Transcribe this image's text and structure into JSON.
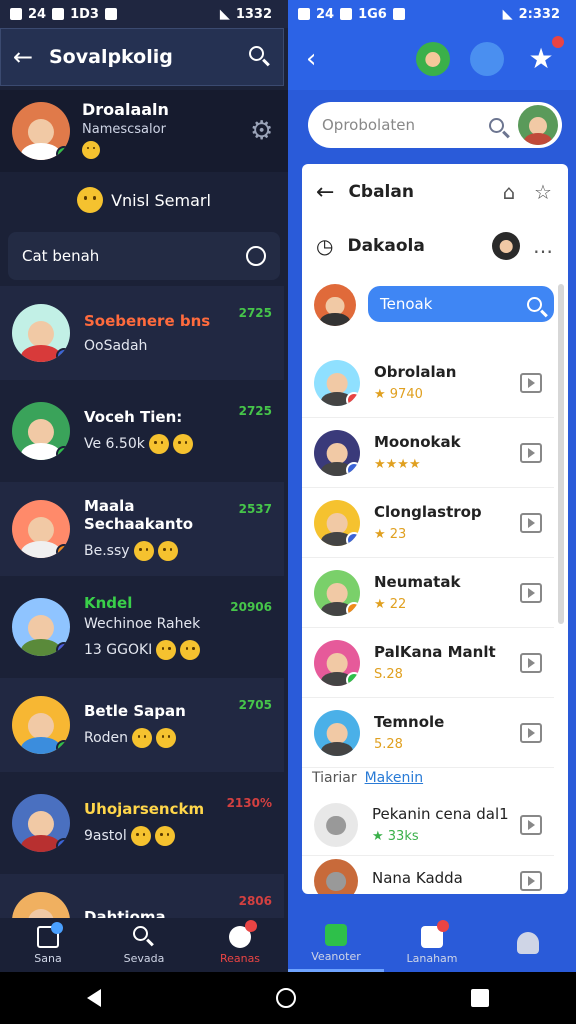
{
  "status_left": {
    "time": "1332",
    "carrier": "24",
    "net": "1D3"
  },
  "status_right": {
    "time": "2:332",
    "carrier": "24",
    "net": "1G6"
  },
  "left_header": {
    "title": "Sovalpkolig"
  },
  "profile": {
    "name": "Droalaaln",
    "sub": "Namescsalor"
  },
  "visit": {
    "label": "Vnisl Semarl"
  },
  "filter": {
    "label": "Cat benah"
  },
  "chats": [
    {
      "name": "Soebenere bns",
      "sub": "OoSadah",
      "time": "2725",
      "name_color": "#ff6b3d",
      "time_color": "green",
      "av": "#c2f0e6",
      "body": "#d83a3a",
      "badge": "#3b64d8"
    },
    {
      "name": "Voceh Tien:",
      "sub": "Ve 6.50k",
      "time": "2725",
      "name_color": "#ffffff",
      "time_color": "green",
      "av": "#3aa35a",
      "body": "#ffffff",
      "badge": "#2ec04a"
    },
    {
      "name": "Maala Sechaakanto",
      "sub": "Be.ssy",
      "time": "2537",
      "name_color": "#ffffff",
      "time_color": "green",
      "av": "#ff8a6a",
      "body": "#f0f0f0",
      "badge": "#f08a1a"
    },
    {
      "name": "Kndel",
      "sub2": "Wechinoe Rahek",
      "sub": "13 GGOKI",
      "time": "20906",
      "name_color": "#3ad04a",
      "time_color": "green",
      "av": "#8fc4ff",
      "body": "#5a8a3a",
      "badge": "#4a5ad8"
    },
    {
      "name": "Betle Sapan",
      "sub": "Roden",
      "time": "2705",
      "name_color": "#ffffff",
      "time_color": "green",
      "av": "#f7b733",
      "body": "#3b8ddd",
      "badge": "#2ec04a"
    },
    {
      "name": "Uhojarsenckm",
      "sub": "9astol",
      "time": "2130%",
      "name_color": "#ffd64a",
      "time_color": "red",
      "av": "#4a70c0",
      "body": "#b83030",
      "badge": "#3b64d8"
    },
    {
      "name": "Dahtioma",
      "sub": "",
      "time": "2806",
      "name_color": "#ffffff",
      "time_color": "red",
      "av": "#f0b060",
      "body": "#8a3a2a",
      "badge": "#3b64d8"
    }
  ],
  "search": {
    "placeholder": "Oprobolaten"
  },
  "card": {
    "back_label": "Cbalan",
    "sub_label": "Dakaola",
    "search_text": "Tenoak"
  },
  "items": [
    {
      "name": "Obrolalan",
      "meta": "★ 9740",
      "av": "#8fe0ff",
      "badge": "#e94444"
    },
    {
      "name": "Moonokak",
      "meta": "★★★★",
      "av": "#3a3a7a",
      "badge": "#3b64d8"
    },
    {
      "name": "Clonglastrop",
      "meta": "★ 23",
      "av": "#f5c22f",
      "badge": "#3b64d8"
    },
    {
      "name": "Neumatak",
      "meta": "★ 22",
      "av": "#7ad06a",
      "badge": "#f08a1a"
    },
    {
      "name": "PalKana Manlt",
      "meta": "S.28",
      "av": "#e65a9a",
      "badge": "#2ec04a"
    },
    {
      "name": "Temnole",
      "meta": "5.28",
      "av": "#4ab0e8",
      "badge": ""
    }
  ],
  "section": {
    "label": "Tiariar",
    "link": "Makenin"
  },
  "items2": [
    {
      "name": "Pekanin cena dal1",
      "meta": "★ 33ks",
      "av": "#e8e8e8"
    },
    {
      "name": "Nana Kadda",
      "meta": "",
      "av": "#c86a3a"
    }
  ],
  "nav": [
    {
      "label": "Sana"
    },
    {
      "label": "Sevada"
    },
    {
      "label": "Reanas"
    },
    {
      "label": "Veanoter"
    },
    {
      "label": "Lanaham"
    },
    {
      "label": ""
    }
  ]
}
